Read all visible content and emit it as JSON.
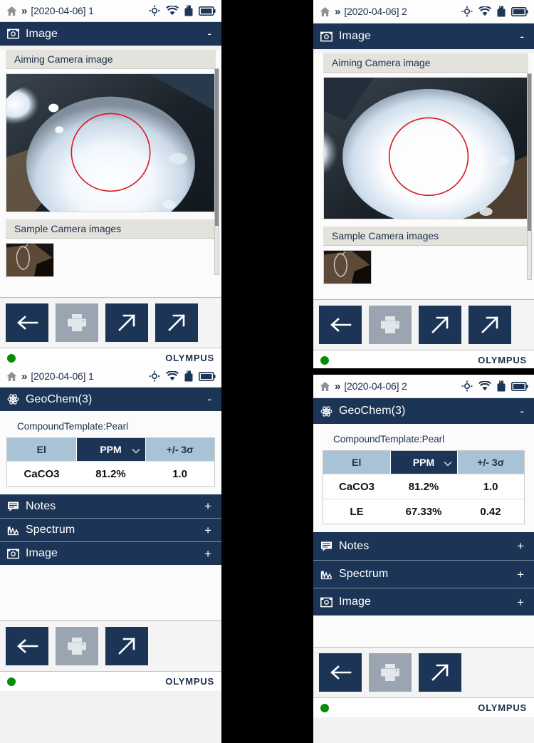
{
  "panels": {
    "top_left": {
      "status": {
        "title": "[2020-04-06] 1",
        "home_icon": "home-icon",
        "chevrons": "»",
        "icons": [
          "target-icon",
          "wifi-icon",
          "usb-icon",
          "battery-icon"
        ]
      },
      "section": {
        "icon": "camera-icon",
        "label": "Image",
        "toggle": "-"
      },
      "aiming_label": "Aiming Camera image",
      "sample_label": "Sample Camera images",
      "toolbar": [
        {
          "name": "back-button",
          "icon": "arrow-left-icon",
          "enabled": true
        },
        {
          "name": "print-button",
          "icon": "printer-icon",
          "enabled": false
        },
        {
          "name": "export-button",
          "icon": "arrow-up-right-icon",
          "enabled": true
        },
        {
          "name": "share-button",
          "icon": "arrow-up-right-icon",
          "enabled": true
        }
      ],
      "footer": {
        "status_color": "#0a8a0a",
        "brand": "OLYMPUS"
      }
    },
    "bottom_left": {
      "status": {
        "title": "[2020-04-06] 1",
        "chevrons": "»"
      },
      "section": {
        "icon": "atom-icon",
        "label": "GeoChem(3)",
        "toggle": "-"
      },
      "template_label": "CompoundTemplate:Pearl",
      "table": {
        "columns": [
          "El",
          "PPM",
          "+/- 3σ"
        ],
        "selected_column": "PPM",
        "rows": [
          [
            "CaCO3",
            "81.2%",
            "1.0"
          ]
        ]
      },
      "sections": [
        {
          "icon": "notes-icon",
          "label": "Notes",
          "toggle": "+"
        },
        {
          "icon": "spectrum-icon",
          "label": "Spectrum",
          "toggle": "+"
        },
        {
          "icon": "camera-icon",
          "label": "Image",
          "toggle": "+"
        }
      ],
      "toolbar": [
        {
          "name": "back-button",
          "icon": "arrow-left-icon",
          "enabled": true
        },
        {
          "name": "print-button",
          "icon": "printer-icon",
          "enabled": false
        },
        {
          "name": "export-button",
          "icon": "arrow-up-right-icon",
          "enabled": true
        }
      ],
      "footer": {
        "status_color": "#0a8a0a",
        "brand": "OLYMPUS"
      }
    },
    "top_right": {
      "status": {
        "title": "[2020-04-06] 2",
        "chevrons": "»"
      },
      "section": {
        "icon": "camera-icon",
        "label": "Image",
        "toggle": "-"
      },
      "aiming_label": "Aiming Camera image",
      "sample_label": "Sample Camera images",
      "toolbar": [
        {
          "name": "back-button",
          "icon": "arrow-left-icon",
          "enabled": true
        },
        {
          "name": "print-button",
          "icon": "printer-icon",
          "enabled": false
        },
        {
          "name": "export-button",
          "icon": "arrow-up-right-icon",
          "enabled": true
        },
        {
          "name": "share-button",
          "icon": "arrow-up-right-icon",
          "enabled": true
        }
      ],
      "footer": {
        "status_color": "#0a8a0a",
        "brand": "OLYMPUS"
      }
    },
    "bottom_right": {
      "status": {
        "title": "[2020-04-06] 2",
        "chevrons": "»"
      },
      "section": {
        "icon": "atom-icon",
        "label": "GeoChem(3)",
        "toggle": "-"
      },
      "template_label": "CompoundTemplate:Pearl",
      "table": {
        "columns": [
          "El",
          "PPM",
          "+/- 3σ"
        ],
        "selected_column": "PPM",
        "rows": [
          [
            "CaCO3",
            "81.2%",
            "1.0"
          ],
          [
            "LE",
            "67.33%",
            "0.42"
          ]
        ]
      },
      "sections": [
        {
          "icon": "notes-icon",
          "label": "Notes",
          "toggle": "+"
        },
        {
          "icon": "spectrum-icon",
          "label": "Spectrum",
          "toggle": "+"
        },
        {
          "icon": "camera-icon",
          "label": "Image",
          "toggle": "+"
        }
      ],
      "toolbar": [
        {
          "name": "back-button",
          "icon": "arrow-left-icon",
          "enabled": true
        },
        {
          "name": "print-button",
          "icon": "printer-icon",
          "enabled": false
        },
        {
          "name": "export-button",
          "icon": "arrow-up-right-icon",
          "enabled": true
        }
      ],
      "footer": {
        "status_color": "#0a8a0a",
        "brand": "OLYMPUS"
      }
    }
  },
  "colors": {
    "header_blue": "#1c3557",
    "status_green": "#0a8a0a",
    "table_header": "#a9c3d6",
    "aim_circle": "#d81a1a"
  }
}
